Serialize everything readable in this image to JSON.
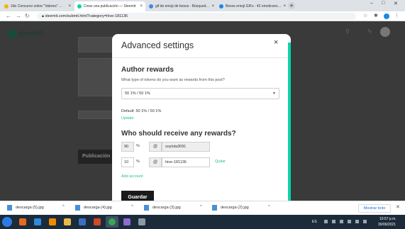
{
  "browser": {
    "tabs": [
      {
        "title": "2do Concurso sobre \"Valores\" …",
        "favicon_color": "#f4b400"
      },
      {
        "title": "Crear una publicación — Steemit",
        "favicon_color": "#06d6a9",
        "active": true
      },
      {
        "title": "gif de emoji de besos - Búsqued…",
        "favicon_color": "#4285f4"
      },
      {
        "title": "Besos emoji GIFs - 42 emoticons…",
        "favicon_color": "#1e88e5"
      }
    ],
    "url": "steemit.com/submit.html?category=hive-181136"
  },
  "background": {
    "logo_text": "steemit",
    "publish_label": "Publicación"
  },
  "modal": {
    "title": "Advanced settings",
    "author_rewards": {
      "heading": "Author rewards",
      "question": "What type of tokens do you want as rewards from this post?",
      "selected": "50 1% / 50 1%",
      "default_text": "Default: 50 1% / 50 1%",
      "update_link": "Update"
    },
    "beneficiaries": {
      "heading": "Who should receive any rewards?",
      "rows": [
        {
          "percent": "90",
          "percent_sign": "%",
          "at": "@",
          "username": "soylola3091"
        },
        {
          "percent": "10",
          "percent_sign": "%",
          "at": "@",
          "username": "hive-181136",
          "remove_label": "Quitar"
        }
      ],
      "add_account": "Add account"
    },
    "save_label": "Guardar"
  },
  "downloads": {
    "items": [
      {
        "name": "descarga (5).jpg"
      },
      {
        "name": "descarga (4).jpg"
      },
      {
        "name": "descarga (3).jpg"
      },
      {
        "name": "descarga (2).jpg"
      }
    ],
    "show_all": "Mostrar todo"
  },
  "taskbar": {
    "language": "ES",
    "time": "10:57 p.m.",
    "date": "30/06/2021"
  },
  "colors": {
    "accent": "#06d6a9",
    "link": "#1fbf8f",
    "save_button": "#1a1a1a"
  }
}
